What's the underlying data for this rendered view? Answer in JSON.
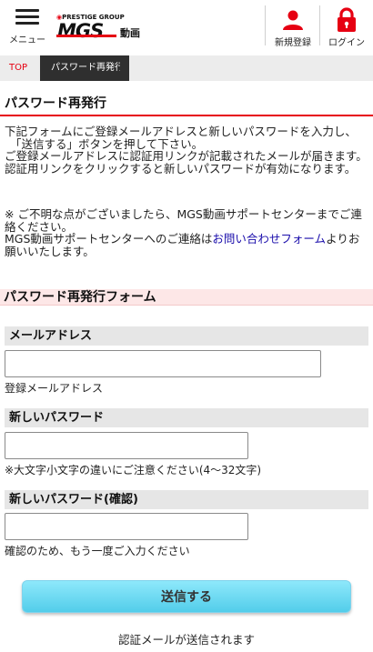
{
  "header": {
    "menu_label": "メニュー",
    "logo": {
      "group_text": "PRESTIGE GROUP",
      "brand": "MGS",
      "sub": "動画"
    },
    "register_label": "新規登録",
    "login_label": "ログイン",
    "accent_color": "#e60012"
  },
  "breadcrumb": {
    "top": "TOP",
    "current": "パスワード再発行"
  },
  "page_title": "パスワード再発行",
  "intro": {
    "line1": "下記フォームにご登録メールアドレスと新しいパスワードを入力し、",
    "line2": "「送信する」ボタンを押して下さい。",
    "line3": "ご登録メールアドレスに認証用リンクが記載されたメールが届きます。認証用リンクをクリックすると新しいパスワードが有効になります。"
  },
  "notice": {
    "line1": "※ ご不明な点がございましたら、MGS動画サポートセンターまでご連絡ください。",
    "line2_prefix": "MGS動画サポートセンターへのご連絡は",
    "link_text": "お問い合わせフォーム",
    "line2_suffix": "よりお願いいたします。"
  },
  "form": {
    "section_title": "パスワード再発行フォーム",
    "email": {
      "label": "メールアドレス",
      "value": "",
      "note": "登録メールアドレス"
    },
    "new_password": {
      "label": "新しいパスワード",
      "value": "",
      "note": "※大文字小文字の違いにご注意ください(4〜32文字)"
    },
    "confirm_password": {
      "label": "新しいパスワード(確認)",
      "value": "",
      "note": "確認のため、もう一度ご入力ください"
    },
    "submit_label": "送信する",
    "footnote": "認証メールが送信されます"
  }
}
